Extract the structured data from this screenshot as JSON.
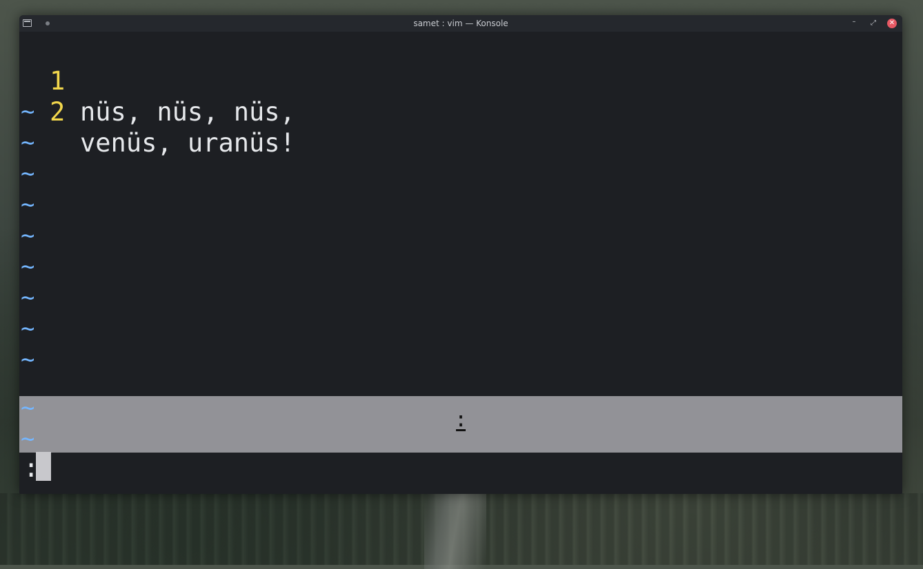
{
  "window": {
    "title": "samet : vim — Konsole",
    "controls": {
      "minimize": "–",
      "maximize": "⤢",
      "close": "✕"
    }
  },
  "editor": {
    "lines": [
      {
        "number": "1",
        "text": "nüs, nüs, nüs,"
      },
      {
        "number": "2",
        "text": "venüs, uranüs!"
      }
    ],
    "empty_marker": "~",
    "empty_line_count": 11
  },
  "command_overlay": {
    "text": ":"
  },
  "command_line": {
    "prompt": ":"
  },
  "colors": {
    "line_number": "#f2d74c",
    "tilde": "#74b6ff",
    "background": "#1d1f23",
    "close_button": "#e65863"
  }
}
